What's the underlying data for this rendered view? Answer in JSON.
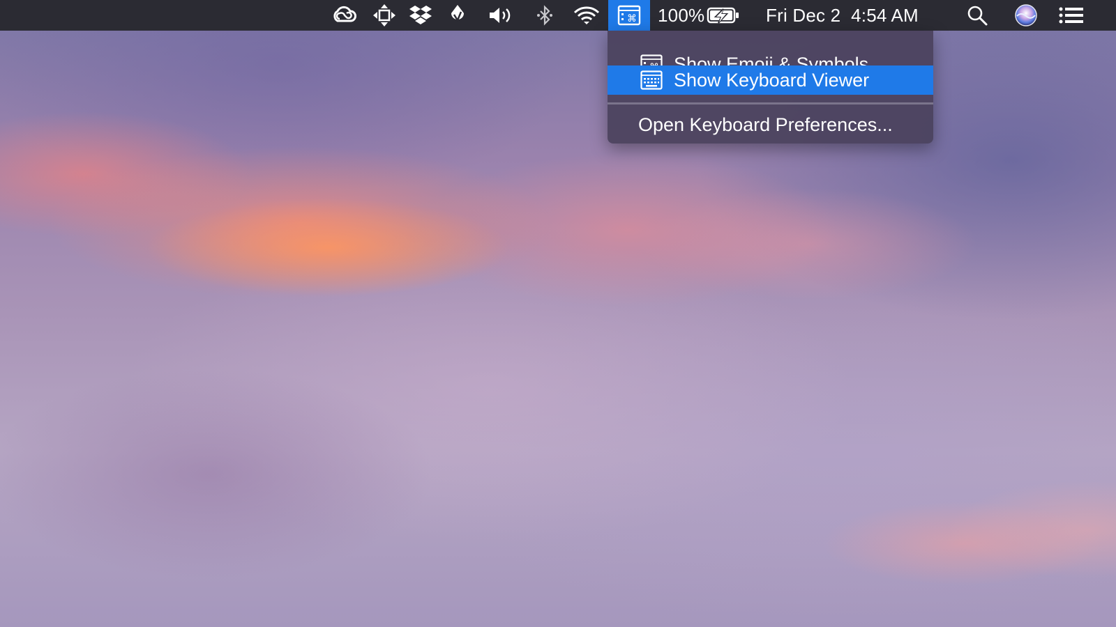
{
  "menubar": {
    "status_icons": [
      "creative-cloud-icon",
      "move-arrows-icon",
      "dropbox-icon",
      "sketch-drop-icon",
      "volume-icon",
      "bluetooth-icon",
      "wifi-icon",
      "input-menu-icon"
    ],
    "battery": {
      "percent_label": "100%",
      "charging": true,
      "level": 1.0
    },
    "clock": "Fri Dec 2  4:54 AM",
    "right_icons": [
      "spotlight-search-icon",
      "siri-icon",
      "notification-center-icon"
    ],
    "active_color": "#1f7ae8",
    "background_color": "#2b2b33"
  },
  "dropdown": {
    "items": [
      {
        "label": "Show Emoji & Symbols",
        "icon": "emoji-symbols-icon",
        "highlighted": false
      },
      {
        "label": "Show Keyboard Viewer",
        "icon": "keyboard-viewer-icon",
        "highlighted": true
      }
    ],
    "footer_item": {
      "label": "Open Keyboard Preferences..."
    },
    "highlight_color": "#1f7ae8"
  }
}
